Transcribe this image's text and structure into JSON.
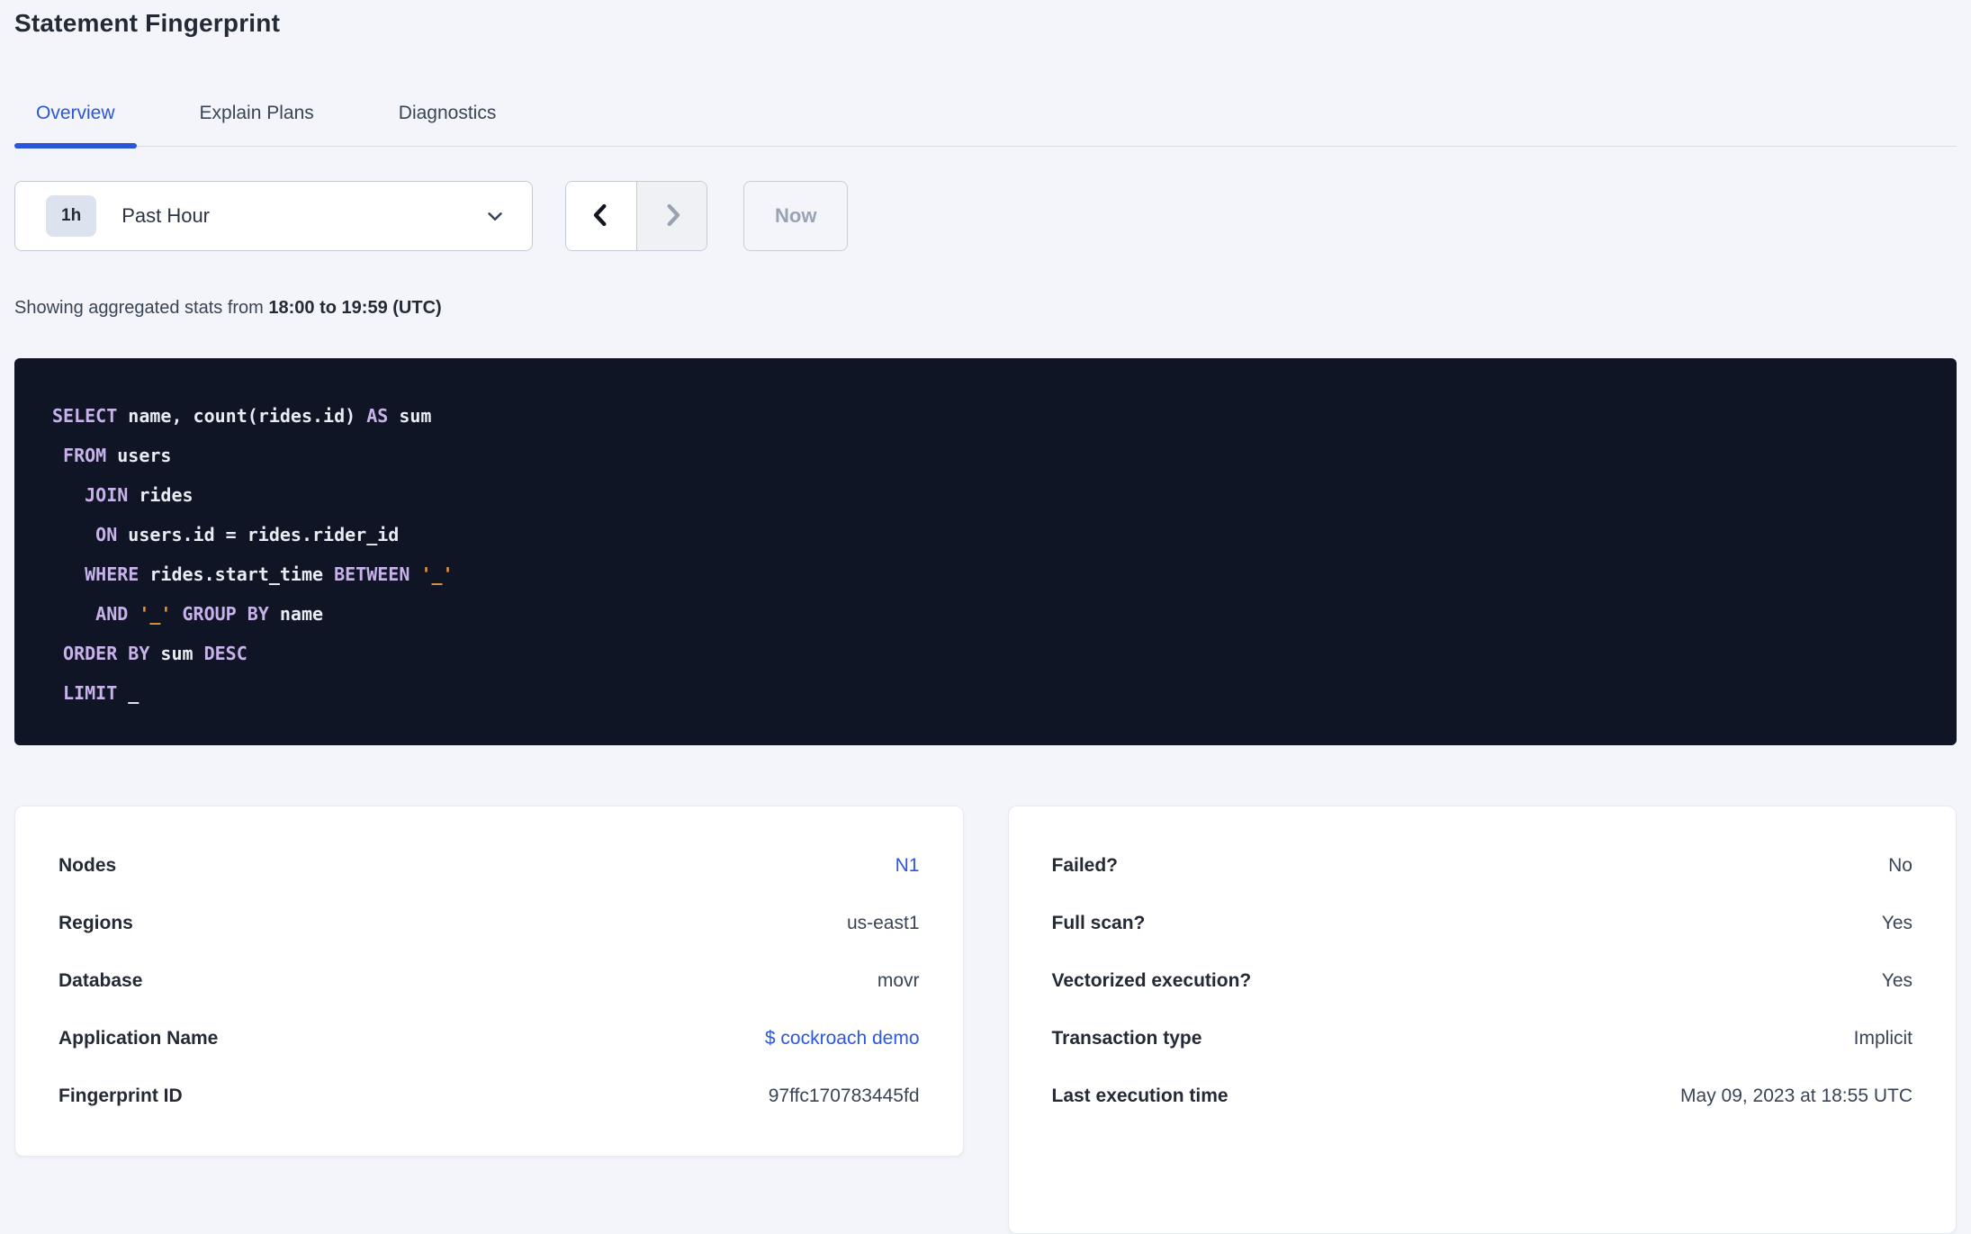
{
  "page": {
    "title": "Statement Fingerprint"
  },
  "tabs": [
    {
      "label": "Overview",
      "active": true
    },
    {
      "label": "Explain Plans",
      "active": false
    },
    {
      "label": "Diagnostics",
      "active": false
    }
  ],
  "time_controls": {
    "range_badge": "1h",
    "range_label": "Past Hour",
    "now_label": "Now",
    "icons": {
      "dropdown": "chevron-down-icon",
      "prev": "chevron-left-icon",
      "next": "chevron-right-icon"
    },
    "prev_enabled": true,
    "next_enabled": false
  },
  "stats_line": {
    "prefix": "Showing aggregated stats from ",
    "range_bold": "18:00 to 19:59 (UTC)"
  },
  "sql": {
    "lines": [
      [
        [
          "kw",
          "SELECT"
        ],
        [
          "id",
          " name, count(rides.id) "
        ],
        [
          "kw",
          "AS"
        ],
        [
          "id",
          " sum"
        ]
      ],
      [
        [
          "id",
          " "
        ],
        [
          "kw",
          "FROM"
        ],
        [
          "id",
          " users"
        ]
      ],
      [
        [
          "id",
          "   "
        ],
        [
          "kw",
          "JOIN"
        ],
        [
          "id",
          " rides"
        ]
      ],
      [
        [
          "id",
          "    "
        ],
        [
          "kw",
          "ON"
        ],
        [
          "id",
          " users.id = rides.rider_id"
        ]
      ],
      [
        [
          "id",
          "   "
        ],
        [
          "kw",
          "WHERE"
        ],
        [
          "id",
          " rides.start_time "
        ],
        [
          "kw",
          "BETWEEN"
        ],
        [
          "id",
          " "
        ],
        [
          "lit",
          "'_'"
        ]
      ],
      [
        [
          "id",
          "    "
        ],
        [
          "kw",
          "AND"
        ],
        [
          "id",
          " "
        ],
        [
          "lit",
          "'_'"
        ],
        [
          "id",
          " "
        ],
        [
          "kw",
          "GROUP BY"
        ],
        [
          "id",
          " name"
        ]
      ],
      [
        [
          "id",
          " "
        ],
        [
          "kw",
          "ORDER BY"
        ],
        [
          "id",
          " sum "
        ],
        [
          "kw",
          "DESC"
        ]
      ],
      [
        [
          "id",
          " "
        ],
        [
          "kw",
          "LIMIT"
        ],
        [
          "id",
          " _"
        ]
      ]
    ]
  },
  "cards": [
    {
      "name": "statement-details",
      "rows": [
        {
          "label": "Nodes",
          "value": "N1",
          "link": true
        },
        {
          "label": "Regions",
          "value": "us-east1",
          "link": false
        },
        {
          "label": "Database",
          "value": "movr",
          "link": false
        },
        {
          "label": "Application Name",
          "value": "$ cockroach demo",
          "link": true
        },
        {
          "label": "Fingerprint ID",
          "value": "97ffc170783445fd",
          "link": false
        }
      ]
    },
    {
      "name": "execution-attributes",
      "rows": [
        {
          "label": "Failed?",
          "value": "No",
          "link": false
        },
        {
          "label": "Full scan?",
          "value": "Yes",
          "link": false
        },
        {
          "label": "Vectorized execution?",
          "value": "Yes",
          "link": false
        },
        {
          "label": "Transaction type",
          "value": "Implicit",
          "link": false
        },
        {
          "label": "Last execution time",
          "value": "May 09, 2023 at 18:55 UTC",
          "link": false
        }
      ]
    }
  ],
  "colors": {
    "accent_blue": "#2955db",
    "link_blue": "#2b57e8",
    "page_background": "#f4f5fa",
    "code_background": "#101525",
    "code_keyword": "#c7b3ea",
    "code_identifier": "#e9ecf3",
    "code_literal": "#e0923f"
  }
}
